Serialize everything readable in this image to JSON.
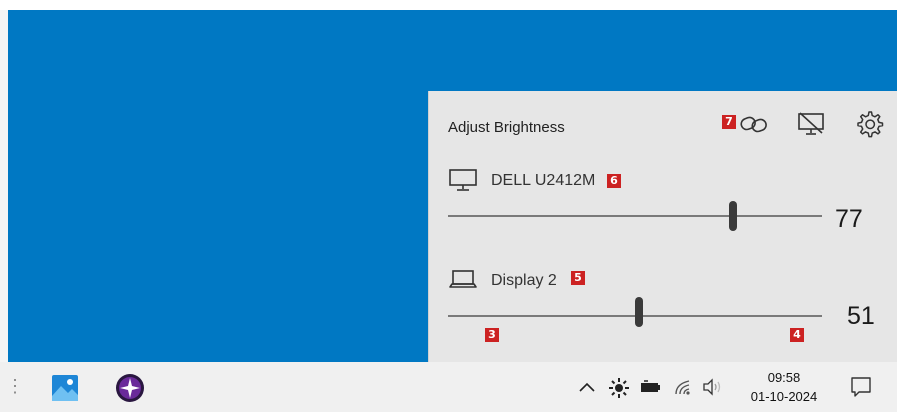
{
  "flyout": {
    "title": "Adjust Brightness",
    "header_icons": [
      "link-icon",
      "display-off-icon",
      "settings-gear-icon"
    ],
    "monitors": [
      {
        "name": "DELL U2412M",
        "icon": "desktop-monitor-icon",
        "brightness": 77,
        "value_label": "77"
      },
      {
        "name": "Display 2",
        "icon": "laptop-icon",
        "brightness": 51,
        "value_label": "51"
      }
    ],
    "badges": {
      "link": "7",
      "monitor1": "6",
      "monitor2": "5",
      "slider_left": "3",
      "slider_right": "4"
    }
  },
  "taskbar": {
    "apps": [
      "photos-app-icon",
      "compass-app-icon"
    ],
    "tray_icons": [
      "chevron-up-icon",
      "brightness-icon",
      "battery-icon",
      "wifi-icon",
      "volume-icon"
    ],
    "clock": {
      "time": "09:58",
      "date": "01-10-2024"
    },
    "notification_icon": "notification-icon"
  },
  "colors": {
    "desktop": "#0078c3",
    "flyout": "#e6e6e6",
    "badge": "#cc2222"
  }
}
